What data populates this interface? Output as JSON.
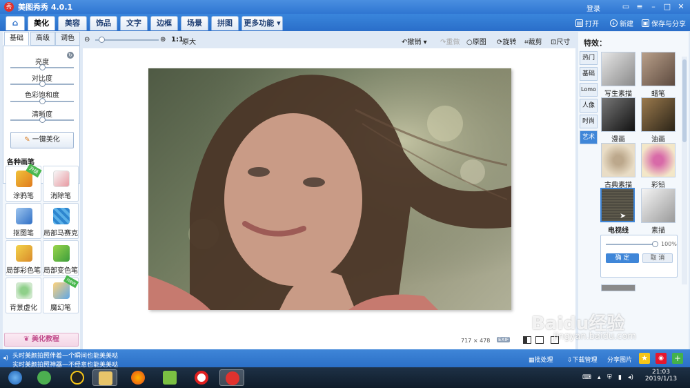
{
  "window": {
    "title": "美图秀秀 4.0.1",
    "logo_text": "秀",
    "login": "登录"
  },
  "menu": {
    "home_icon": "home-icon",
    "tabs": [
      "美化",
      "美容",
      "饰品",
      "文字",
      "边框",
      "场景",
      "拼图"
    ],
    "more": "更多功能",
    "actions": {
      "open": "打开",
      "new": "新建",
      "save_share": "保存与分享"
    }
  },
  "left": {
    "tabs": [
      "基础",
      "高级",
      "调色"
    ],
    "sliders": [
      {
        "label": "亮度",
        "level": 0.5
      },
      {
        "label": "对比度",
        "level": 0.5
      },
      {
        "label": "色彩饱和度",
        "level": 0.5
      },
      {
        "label": "清晰度",
        "level": 0.5
      }
    ],
    "one_key": "一键美化",
    "brush_heading": "各种画笔",
    "tools": [
      {
        "label": "涂鸦笔",
        "badge": "升级"
      },
      {
        "label": "消除笔"
      },
      {
        "label": "抠图笔"
      },
      {
        "label": "局部马赛克"
      },
      {
        "label": "局部彩色笔"
      },
      {
        "label": "局部变色笔"
      },
      {
        "label": "背景虚化"
      },
      {
        "label": "魔幻笔",
        "badge": "new"
      }
    ],
    "tutorial": "美化教程"
  },
  "toolbar": {
    "ratio": "1:1",
    "original_size": "原大",
    "undo": "撤销",
    "redo": "重做",
    "original": "原图",
    "rotate": "旋转",
    "crop": "裁剪",
    "resize": "尺寸",
    "zoom_level": 0.05
  },
  "image": {
    "width_px": "717",
    "times": "×",
    "height_px": "478",
    "exif": "EXIF"
  },
  "right": {
    "heading": "特效：",
    "tabs": [
      "热门",
      "基础",
      "Lomo",
      "人像",
      "时尚",
      "艺术"
    ],
    "active_tab": "艺术",
    "effects": [
      "写生素描",
      "蜡笔",
      "漫画",
      "油画",
      "古典素描",
      "彩铅",
      "电视线",
      "素描"
    ],
    "selected_effect": "电视线",
    "opacity": "100%",
    "ok": "确 定",
    "cancel": "取 消"
  },
  "status": {
    "news1": "头时美颜拍照伴着一个瞬间也能美美哒",
    "news2": "实时美颜拍照神器一不经意也能美美哒",
    "batch": "批处理",
    "download": "下载管理",
    "share": "分享图片"
  },
  "taskbar": {
    "time": "21:03",
    "date": "2019/1/13"
  },
  "watermark": {
    "brand": "Baidu经验",
    "url": "jingyan.baidu.com"
  },
  "colors": {
    "accent": "#3f86d8",
    "title_bar": "#2f76d2",
    "logo_red": "#e0322e"
  }
}
